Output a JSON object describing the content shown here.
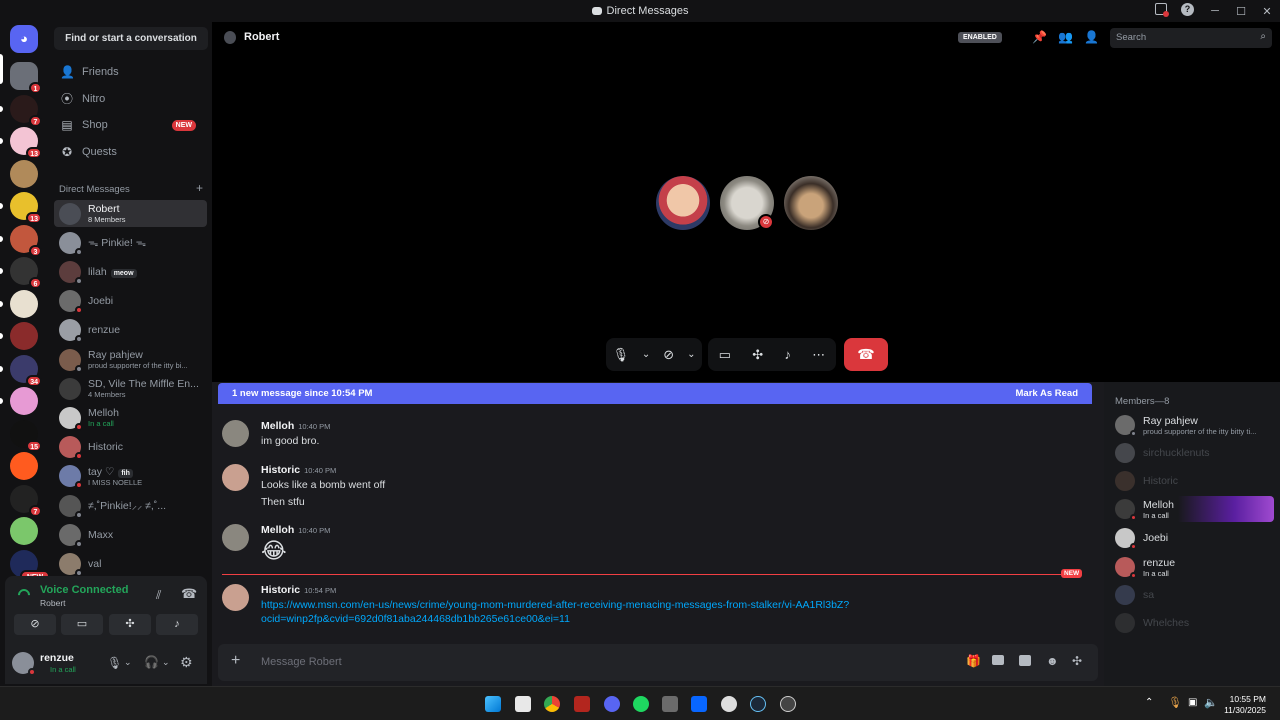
{
  "window": {
    "title": "Direct Messages"
  },
  "sidebar": {
    "find_placeholder": "Find or start a conversation",
    "nav": [
      {
        "label": "Friends",
        "icon": "friends-icon"
      },
      {
        "label": "Nitro",
        "icon": "nitro-icon"
      },
      {
        "label": "Shop",
        "icon": "shop-icon",
        "badge": "NEW"
      },
      {
        "label": "Quests",
        "icon": "quests-icon"
      }
    ],
    "dm_header": "Direct Messages",
    "dm_add": "+",
    "dms": [
      {
        "name": "Robert",
        "sub": "8 Members",
        "selected": true
      },
      {
        "name": "ᯓ Pinkie! ᯓ",
        "sub": ""
      },
      {
        "name": "lilah",
        "tag": "meow",
        "sub": ""
      },
      {
        "name": "Joebi",
        "sub": ""
      },
      {
        "name": "renzue",
        "sub": ""
      },
      {
        "name": "Ray pahjew",
        "sub": "proud supporter of the itty bi..."
      },
      {
        "name": "SD, Vile The Miffle En...",
        "sub": "4 Members"
      },
      {
        "name": "Melloh",
        "sub": "In a call"
      },
      {
        "name": "Historic",
        "sub": ""
      },
      {
        "name": "tay ♡",
        "tag": "fih",
        "sub": "I MISS NOELLE"
      },
      {
        "name": "≠,˚Pinkie!⸝⸝ ≠,˚...",
        "sub": ""
      },
      {
        "name": "Maxx",
        "sub": ""
      },
      {
        "name": "val",
        "sub": ""
      }
    ],
    "servers": [
      {
        "badge": "1"
      },
      {
        "badge": "7"
      },
      {
        "badge": "13"
      },
      {
        "badge": ""
      },
      {
        "badge": "13"
      },
      {
        "badge": "3"
      },
      {
        "badge": "6"
      },
      {
        "badge": ""
      },
      {
        "badge": ""
      },
      {
        "badge": "34"
      },
      {
        "badge": ""
      },
      {
        "badge": "15"
      },
      {
        "badge": ""
      },
      {
        "badge": "7"
      },
      {
        "badge": ""
      },
      {
        "badge": "NEW"
      }
    ]
  },
  "voice": {
    "status": "Voice Connected",
    "channel": "Robert"
  },
  "user": {
    "name": "renzue",
    "status": "In a call"
  },
  "chat": {
    "header_name": "Robert",
    "enabled_badge": "ENABLED",
    "search_placeholder": "Search",
    "new_bar_text": "1 new message since 10:54 PM",
    "mark_read": "Mark As Read",
    "new_tag": "NEW",
    "compose_placeholder": "Message Robert",
    "messages": [
      {
        "author": "Melloh",
        "time": "10:40 PM",
        "lines": [
          "im good bro."
        ]
      },
      {
        "author": "Historic",
        "time": "10:40 PM",
        "lines": [
          "Looks like a bomb went off",
          "Then stfu"
        ]
      },
      {
        "author": "Melloh",
        "time": "10:40 PM",
        "lines": [
          "😂"
        ]
      },
      {
        "author": "Historic",
        "time": "10:54 PM",
        "lines": [
          "https://www.msn.com/en-us/news/crime/young-mom-murdered-after-receiving-menacing-messages-from-stalker/vi-AA1Rl3bZ?",
          "ocid=winp2fp&cvid=692d0f81aba244468db1bb265e61ce00&ei=11"
        ]
      }
    ]
  },
  "members": {
    "header": "Members—8",
    "list": [
      {
        "name": "Ray pahjew",
        "sub": "proud supporter of the itty bitty ti...",
        "dim": false
      },
      {
        "name": "sirchucklenuts",
        "sub": "",
        "dim": true
      },
      {
        "name": "Historic",
        "sub": "",
        "dim": true
      },
      {
        "name": "Melloh",
        "sub": "In a call",
        "dim": false
      },
      {
        "name": "Joebi",
        "sub": "",
        "dim": false
      },
      {
        "name": "renzue",
        "sub": "In a call",
        "dim": false
      },
      {
        "name": "sa",
        "sub": "",
        "dim": true
      },
      {
        "name": "Whelches",
        "sub": "",
        "dim": true
      }
    ]
  },
  "taskbar": {
    "time": "10:55 PM",
    "date": "11/30/2025"
  }
}
